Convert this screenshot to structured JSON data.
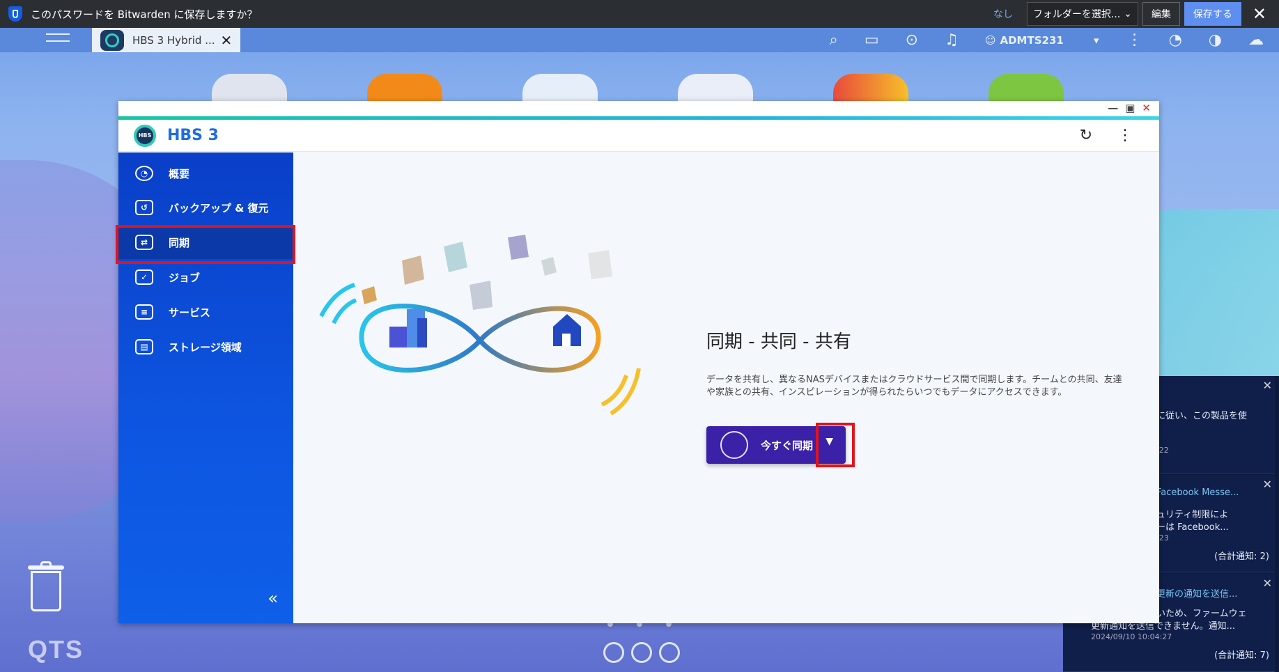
{
  "bitwarden": {
    "message": "このパスワードを Bitwarden に保存しますか？",
    "none_label": "なし",
    "folder_select": "フォルダーを選択...",
    "edit_label": "編集",
    "save_label": "保存する"
  },
  "qts": {
    "tab_title": "HBS 3 Hybrid ...",
    "username": "ADMTS231",
    "logo_text": "QTS"
  },
  "window": {
    "app_title": "HBS 3"
  },
  "sidebar": {
    "items": [
      {
        "label": "概要",
        "icon": "gauge-icon"
      },
      {
        "label": "バックアップ & 復元",
        "icon": "backup-icon"
      },
      {
        "label": "同期",
        "icon": "sync-icon"
      },
      {
        "label": "ジョブ",
        "icon": "job-icon"
      },
      {
        "label": "サービス",
        "icon": "service-icon"
      },
      {
        "label": "ストレージ領域",
        "icon": "storage-icon"
      }
    ],
    "active_index": 2
  },
  "main": {
    "title": "同期 - 共同 - 共有",
    "description": "データを共有し、異なるNASデバイスまたはクラウドサービス間で同期します。チームとの共同、友達や家族との共有、インスピレーションが得られたらいつでもデータにアクセスできます。",
    "sync_button_label": "今すぐ同期"
  },
  "notifications": [
    {
      "text_1": "に従い、この製品を使",
      "time": ":22",
      "total": ""
    },
    {
      "title": "Facebook Messe...",
      "text_1": "ュリティ制限によ",
      "text_2": "ーは Facebook...",
      "time": ":23",
      "total": "(合計通知: 2)"
    },
    {
      "title": "更新の通知を送信...",
      "text_1": "いため、ファームウェ",
      "text_2": "更新通知を送信できません。通知...",
      "time": "2024/09/10 10:04:27",
      "total": "(合計通知: 7)"
    }
  ],
  "colors": {
    "accent": "#1d6de0",
    "sidebar": "#0d56e1",
    "sync_button": "#3b20a8",
    "highlight": "#e3131b"
  }
}
